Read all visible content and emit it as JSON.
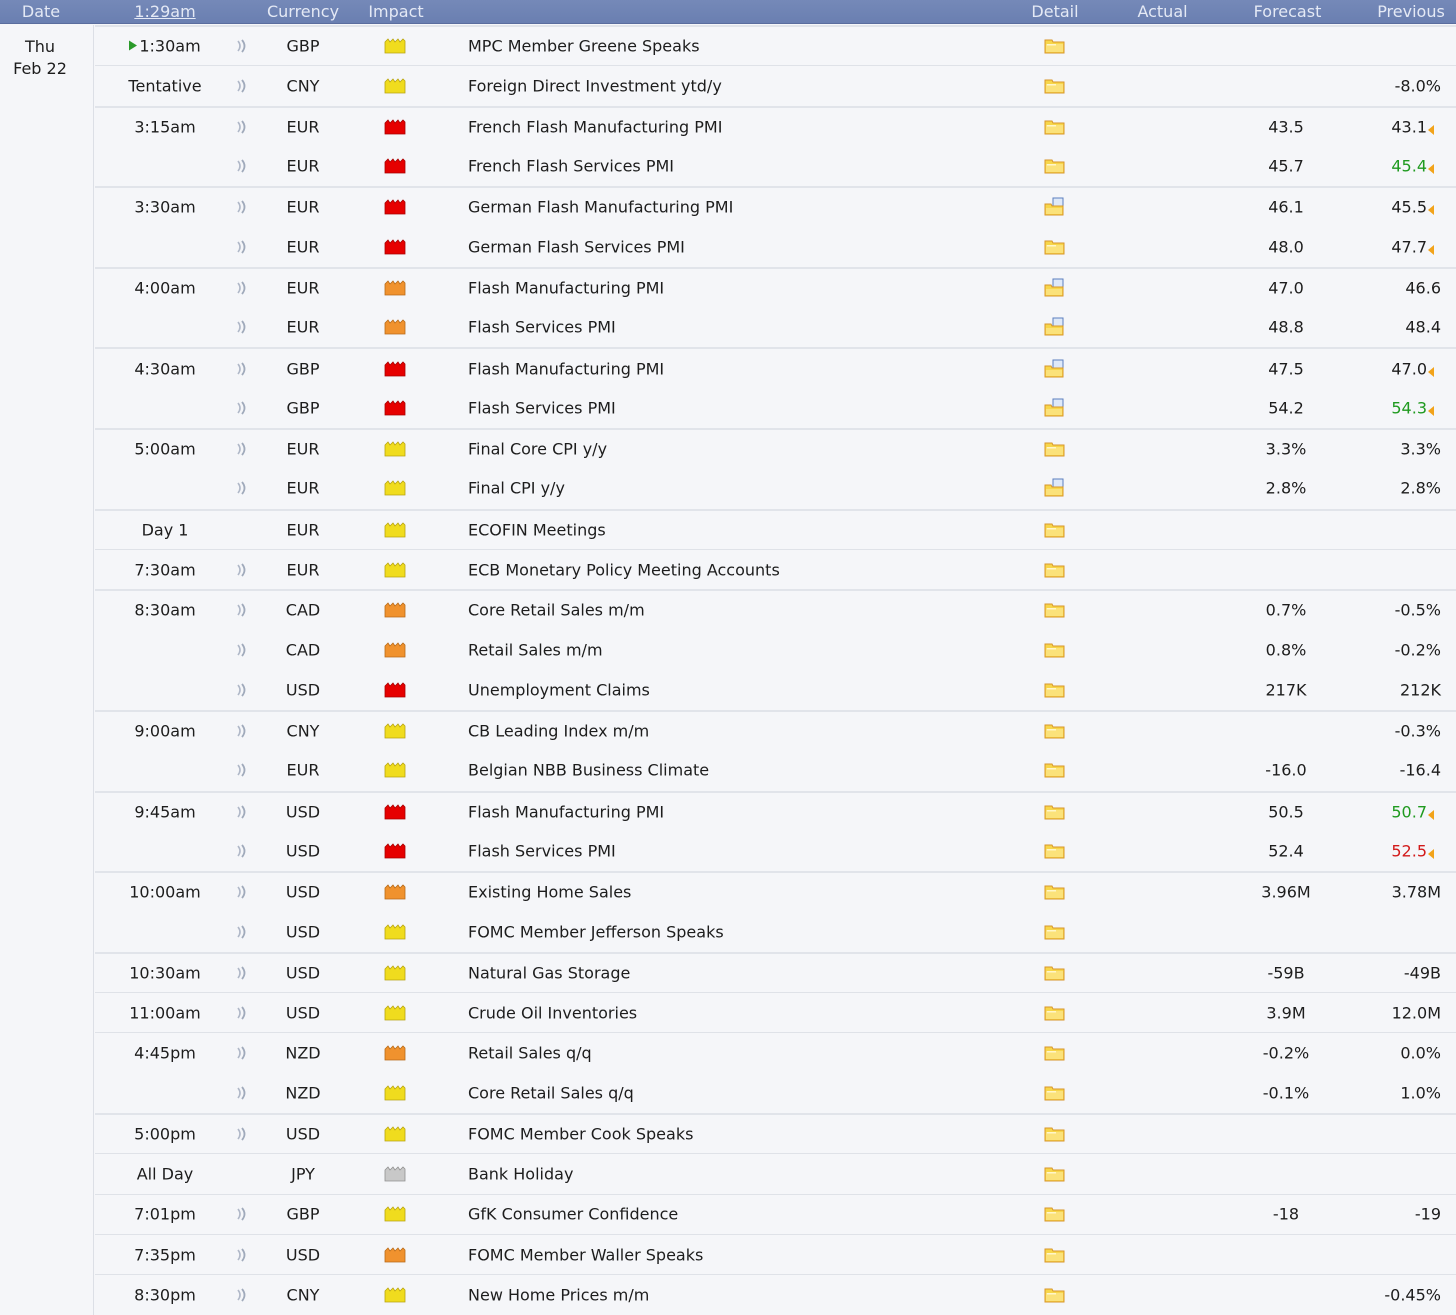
{
  "header": {
    "date": "Date",
    "time": "1:29am",
    "currency": "Currency",
    "impact": "Impact",
    "detail": "Detail",
    "actual": "Actual",
    "forecast": "Forecast",
    "previous": "Previous"
  },
  "date": {
    "weekday": "Thu",
    "day": "Feb 22"
  },
  "colors": {
    "impact_high": "#e60000",
    "impact_medium": "#f0922e",
    "impact_low": "#f0dc1e",
    "impact_holiday": "#c8c8c8",
    "better": "#1f9a1f",
    "worse": "#d21a1a",
    "revised_marker": "#f2a31a"
  },
  "events": [
    {
      "time": "1:30am",
      "current": true,
      "sound": true,
      "currency": "GBP",
      "impact": "low",
      "title": "MPC Member Greene Speaks",
      "detail": "folder",
      "actual": "",
      "forecast": "",
      "previous": "",
      "prev_color": "",
      "revised": false,
      "sep": "strong"
    },
    {
      "time": "Tentative",
      "sound": true,
      "currency": "CNY",
      "impact": "low",
      "title": "Foreign Direct Investment ytd/y",
      "detail": "folder",
      "actual": "",
      "forecast": "",
      "previous": "-8.0%",
      "prev_color": "",
      "revised": false,
      "sep": "normal"
    },
    {
      "time": "3:15am",
      "sound": true,
      "currency": "EUR",
      "impact": "high",
      "title": "French Flash Manufacturing PMI",
      "detail": "folder",
      "actual": "",
      "forecast": "43.5",
      "previous": "43.1",
      "prev_color": "",
      "revised": true,
      "sep": "strong"
    },
    {
      "time": "",
      "sound": true,
      "currency": "EUR",
      "impact": "high",
      "title": "French Flash Services PMI",
      "detail": "folder",
      "actual": "",
      "forecast": "45.7",
      "previous": "45.4",
      "prev_color": "green",
      "revised": true,
      "sep": ""
    },
    {
      "time": "3:30am",
      "sound": true,
      "currency": "EUR",
      "impact": "high",
      "title": "German Flash Manufacturing PMI",
      "detail": "folder-doc",
      "actual": "",
      "forecast": "46.1",
      "previous": "45.5",
      "prev_color": "",
      "revised": true,
      "sep": "strong"
    },
    {
      "time": "",
      "sound": true,
      "currency": "EUR",
      "impact": "high",
      "title": "German Flash Services PMI",
      "detail": "folder",
      "actual": "",
      "forecast": "48.0",
      "previous": "47.7",
      "prev_color": "",
      "revised": true,
      "sep": ""
    },
    {
      "time": "4:00am",
      "sound": true,
      "currency": "EUR",
      "impact": "medium",
      "title": "Flash Manufacturing PMI",
      "detail": "folder-doc",
      "actual": "",
      "forecast": "47.0",
      "previous": "46.6",
      "prev_color": "",
      "revised": false,
      "sep": "strong"
    },
    {
      "time": "",
      "sound": true,
      "currency": "EUR",
      "impact": "medium",
      "title": "Flash Services PMI",
      "detail": "folder-doc",
      "actual": "",
      "forecast": "48.8",
      "previous": "48.4",
      "prev_color": "",
      "revised": false,
      "sep": ""
    },
    {
      "time": "4:30am",
      "sound": true,
      "currency": "GBP",
      "impact": "high",
      "title": "Flash Manufacturing PMI",
      "detail": "folder-doc",
      "actual": "",
      "forecast": "47.5",
      "previous": "47.0",
      "prev_color": "",
      "revised": true,
      "sep": "strong"
    },
    {
      "time": "",
      "sound": true,
      "currency": "GBP",
      "impact": "high",
      "title": "Flash Services PMI",
      "detail": "folder-doc",
      "actual": "",
      "forecast": "54.2",
      "previous": "54.3",
      "prev_color": "green",
      "revised": true,
      "sep": ""
    },
    {
      "time": "5:00am",
      "sound": true,
      "currency": "EUR",
      "impact": "low",
      "title": "Final Core CPI y/y",
      "detail": "folder",
      "actual": "",
      "forecast": "3.3%",
      "previous": "3.3%",
      "prev_color": "",
      "revised": false,
      "sep": "strong"
    },
    {
      "time": "",
      "sound": true,
      "currency": "EUR",
      "impact": "low",
      "title": "Final CPI y/y",
      "detail": "folder-doc",
      "actual": "",
      "forecast": "2.8%",
      "previous": "2.8%",
      "prev_color": "",
      "revised": false,
      "sep": ""
    },
    {
      "time": "Day 1",
      "sound": false,
      "currency": "EUR",
      "impact": "low",
      "title": "ECOFIN Meetings",
      "detail": "folder",
      "actual": "",
      "forecast": "",
      "previous": "",
      "prev_color": "",
      "revised": false,
      "sep": "strong"
    },
    {
      "time": "7:30am",
      "sound": true,
      "currency": "EUR",
      "impact": "low",
      "title": "ECB Monetary Policy Meeting Accounts",
      "detail": "folder",
      "actual": "",
      "forecast": "",
      "previous": "",
      "prev_color": "",
      "revised": false,
      "sep": "normal"
    },
    {
      "time": "8:30am",
      "sound": true,
      "currency": "CAD",
      "impact": "medium",
      "title": "Core Retail Sales m/m",
      "detail": "folder",
      "actual": "",
      "forecast": "0.7%",
      "previous": "-0.5%",
      "prev_color": "",
      "revised": false,
      "sep": "strong"
    },
    {
      "time": "",
      "sound": true,
      "currency": "CAD",
      "impact": "medium",
      "title": "Retail Sales m/m",
      "detail": "folder",
      "actual": "",
      "forecast": "0.8%",
      "previous": "-0.2%",
      "prev_color": "",
      "revised": false,
      "sep": ""
    },
    {
      "time": "",
      "sound": true,
      "currency": "USD",
      "impact": "high",
      "title": "Unemployment Claims",
      "detail": "folder",
      "actual": "",
      "forecast": "217K",
      "previous": "212K",
      "prev_color": "",
      "revised": false,
      "sep": ""
    },
    {
      "time": "9:00am",
      "sound": true,
      "currency": "CNY",
      "impact": "low",
      "title": "CB Leading Index m/m",
      "detail": "folder",
      "actual": "",
      "forecast": "",
      "previous": "-0.3%",
      "prev_color": "",
      "revised": false,
      "sep": "strong"
    },
    {
      "time": "",
      "sound": true,
      "currency": "EUR",
      "impact": "low",
      "title": "Belgian NBB Business Climate",
      "detail": "folder",
      "actual": "",
      "forecast": "-16.0",
      "previous": "-16.4",
      "prev_color": "",
      "revised": false,
      "sep": ""
    },
    {
      "time": "9:45am",
      "sound": true,
      "currency": "USD",
      "impact": "high",
      "title": "Flash Manufacturing PMI",
      "detail": "folder",
      "actual": "",
      "forecast": "50.5",
      "previous": "50.7",
      "prev_color": "green",
      "revised": true,
      "sep": "strong"
    },
    {
      "time": "",
      "sound": true,
      "currency": "USD",
      "impact": "high",
      "title": "Flash Services PMI",
      "detail": "folder",
      "actual": "",
      "forecast": "52.4",
      "previous": "52.5",
      "prev_color": "red",
      "revised": true,
      "sep": ""
    },
    {
      "time": "10:00am",
      "sound": true,
      "currency": "USD",
      "impact": "medium",
      "title": "Existing Home Sales",
      "detail": "folder",
      "actual": "",
      "forecast": "3.96M",
      "previous": "3.78M",
      "prev_color": "",
      "revised": false,
      "sep": "strong"
    },
    {
      "time": "",
      "sound": true,
      "currency": "USD",
      "impact": "low",
      "title": "FOMC Member Jefferson Speaks",
      "detail": "folder",
      "actual": "",
      "forecast": "",
      "previous": "",
      "prev_color": "",
      "revised": false,
      "sep": ""
    },
    {
      "time": "10:30am",
      "sound": true,
      "currency": "USD",
      "impact": "low",
      "title": "Natural Gas Storage",
      "detail": "folder",
      "actual": "",
      "forecast": "-59B",
      "previous": "-49B",
      "prev_color": "",
      "revised": false,
      "sep": "strong"
    },
    {
      "time": "11:00am",
      "sound": true,
      "currency": "USD",
      "impact": "low",
      "title": "Crude Oil Inventories",
      "detail": "folder",
      "actual": "",
      "forecast": "3.9M",
      "previous": "12.0M",
      "prev_color": "",
      "revised": false,
      "sep": "normal"
    },
    {
      "time": "4:45pm",
      "sound": true,
      "currency": "NZD",
      "impact": "medium",
      "title": "Retail Sales q/q",
      "detail": "folder",
      "actual": "",
      "forecast": "-0.2%",
      "previous": "0.0%",
      "prev_color": "",
      "revised": false,
      "sep": "normal"
    },
    {
      "time": "",
      "sound": true,
      "currency": "NZD",
      "impact": "low",
      "title": "Core Retail Sales q/q",
      "detail": "folder",
      "actual": "",
      "forecast": "-0.1%",
      "previous": "1.0%",
      "prev_color": "",
      "revised": false,
      "sep": ""
    },
    {
      "time": "5:00pm",
      "sound": true,
      "currency": "USD",
      "impact": "low",
      "title": "FOMC Member Cook Speaks",
      "detail": "folder",
      "actual": "",
      "forecast": "",
      "previous": "",
      "prev_color": "",
      "revised": false,
      "sep": "strong"
    },
    {
      "time": "All Day",
      "sound": false,
      "currency": "JPY",
      "impact": "holiday",
      "title": "Bank Holiday",
      "detail": "folder",
      "actual": "",
      "forecast": "",
      "previous": "",
      "prev_color": "",
      "revised": false,
      "sep": "normal"
    },
    {
      "time": "7:01pm",
      "sound": true,
      "currency": "GBP",
      "impact": "low",
      "title": "GfK Consumer Confidence",
      "detail": "folder",
      "actual": "",
      "forecast": "-18",
      "previous": "-19",
      "prev_color": "",
      "revised": false,
      "sep": "normal"
    },
    {
      "time": "7:35pm",
      "sound": true,
      "currency": "USD",
      "impact": "medium",
      "title": "FOMC Member Waller Speaks",
      "detail": "folder",
      "actual": "",
      "forecast": "",
      "previous": "",
      "prev_color": "",
      "revised": false,
      "sep": "normal"
    },
    {
      "time": "8:30pm",
      "sound": true,
      "currency": "CNY",
      "impact": "low",
      "title": "New Home Prices m/m",
      "detail": "folder",
      "actual": "",
      "forecast": "",
      "previous": "-0.45%",
      "prev_color": "",
      "revised": false,
      "sep": "normal"
    }
  ]
}
